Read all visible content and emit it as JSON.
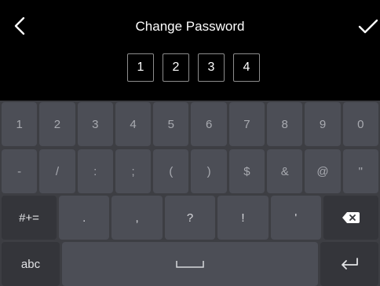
{
  "header": {
    "title": "Change Password",
    "back_icon": "chevron-left-icon",
    "confirm_icon": "checkmark-icon"
  },
  "pin": [
    "1",
    "2",
    "3",
    "4"
  ],
  "keyboard": {
    "row1": [
      "1",
      "2",
      "3",
      "4",
      "5",
      "6",
      "7",
      "8",
      "9",
      "0"
    ],
    "row2": [
      "-",
      "/",
      ":",
      ";",
      "(",
      ")",
      "$",
      "&",
      "@",
      "\""
    ],
    "row3": {
      "mode": "#+=",
      "keys": [
        ".",
        ",",
        "?",
        "!",
        "'"
      ],
      "delete_icon": "backspace-icon"
    },
    "row4": {
      "mode": "abc",
      "space_icon": "space-bar-icon",
      "return_icon": "return-icon"
    }
  },
  "colors": {
    "background": "#000000",
    "keyboard_bg": "#3d3e43",
    "key_bg": "#4c4e56",
    "function_key_bg": "#34353a"
  }
}
